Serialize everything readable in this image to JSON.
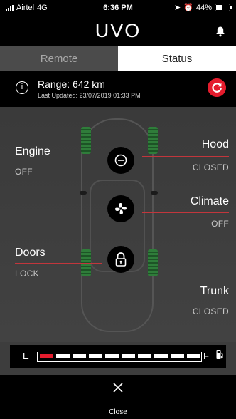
{
  "status_bar": {
    "carrier": "Airtel",
    "network": "4G",
    "time": "6:36 PM",
    "battery": "44%"
  },
  "header": {
    "logo": "UVO"
  },
  "tabs": [
    {
      "label": "Remote"
    },
    {
      "label": "Status"
    }
  ],
  "range": {
    "title": "Range: 642 km",
    "last_updated": "Last Updated: 23/07/2019 01:33 PM"
  },
  "status": {
    "engine": {
      "label": "Engine",
      "value": "OFF"
    },
    "hood": {
      "label": "Hood",
      "value": "CLOSED"
    },
    "climate": {
      "label": "Climate",
      "value": "OFF"
    },
    "doors": {
      "label": "Doors",
      "value": "LOCK"
    },
    "trunk": {
      "label": "Trunk",
      "value": "CLOSED"
    }
  },
  "fuel": {
    "empty_label": "E",
    "full_label": "F",
    "level_segments": 1,
    "total_segments": 10
  },
  "footer": {
    "close_label": "Close"
  },
  "colors": {
    "accent_red": "#e41c2d",
    "tab_active_bg": "#ffffff",
    "tab_inactive_bg": "#4b4b4b",
    "wheel_green": "#2f7d3a"
  }
}
